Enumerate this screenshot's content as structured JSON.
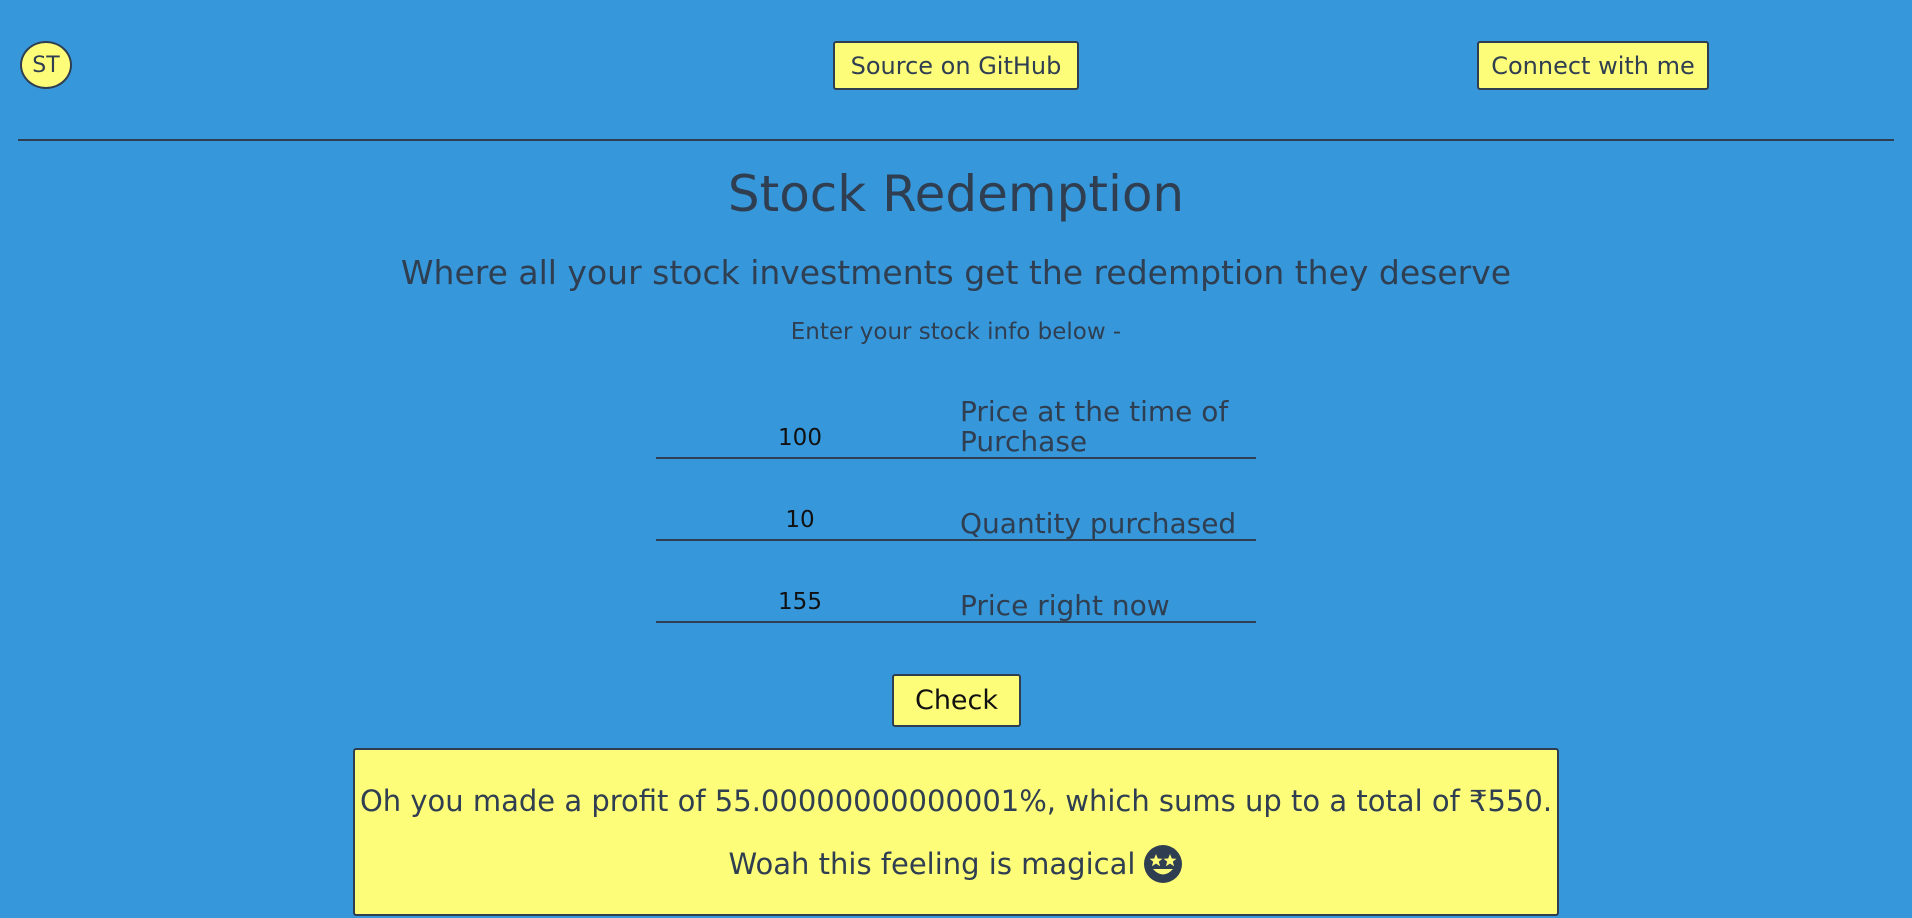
{
  "nav": {
    "avatar_initials": "ST",
    "github_label": "Source on GitHub",
    "connect_label": "Connect with me"
  },
  "header": {
    "title": "Stock Redemption",
    "subtitle": "Where all your stock investments get the redemption they deserve",
    "prompt": "Enter your stock info below -"
  },
  "form": {
    "purchase_price": {
      "value": "100",
      "label": "Price at the time of Purchase"
    },
    "quantity": {
      "value": "10",
      "label": "Quantity purchased"
    },
    "current_price": {
      "value": "155",
      "label": "Price right now"
    },
    "check_label": "Check"
  },
  "result": {
    "message": "Oh you made a profit of 55.00000000000001%, which sums up to a total of ₹550.",
    "feeling": "Woah this feeling is magical",
    "emoji_icon": "star-struck-face-icon"
  },
  "colors": {
    "background": "#3698db",
    "accent": "#fefd7a",
    "text": "#2f3e50"
  }
}
